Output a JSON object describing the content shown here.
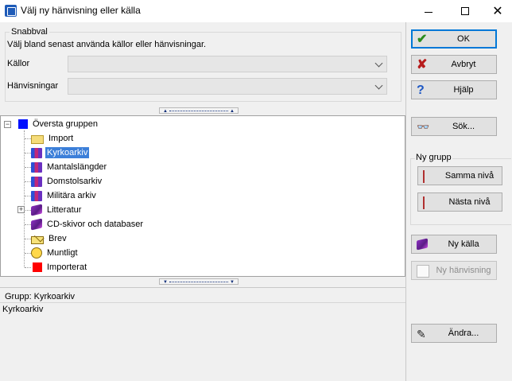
{
  "window": {
    "title": "Välj ny hänvisning eller källa",
    "minimize": "—",
    "maximize": "☐",
    "close": "✕"
  },
  "quick": {
    "title": "Snabbval",
    "description": "Välj bland senast använda källor eller hänvisningar.",
    "sources_label": "Källor",
    "sources_value": "",
    "references_label": "Hänvisningar",
    "references_value": ""
  },
  "tree": {
    "root": {
      "label": "Översta gruppen",
      "icon": "blue-square-icon",
      "expander": "−"
    },
    "items": [
      {
        "label": "Import",
        "icon": "folder-icon",
        "selected": false
      },
      {
        "label": "Kyrkoarkiv",
        "icon": "books-icon",
        "selected": true
      },
      {
        "label": "Mantalslängder",
        "icon": "books-icon",
        "selected": false
      },
      {
        "label": "Domstolsarkiv",
        "icon": "books-icon",
        "selected": false
      },
      {
        "label": "Militära arkiv",
        "icon": "books-icon",
        "selected": false
      },
      {
        "label": "Litteratur",
        "icon": "book-icon",
        "selected": false,
        "expander": "+"
      },
      {
        "label": "CD-skivor och databaser",
        "icon": "book-icon",
        "selected": false
      },
      {
        "label": "Brev",
        "icon": "envelope-icon",
        "selected": false
      },
      {
        "label": "Muntligt",
        "icon": "face-icon",
        "selected": false
      },
      {
        "label": "Importerat",
        "icon": "red-square-icon",
        "selected": false
      }
    ]
  },
  "info": {
    "group_label": "Grupp: Kyrkoarkiv",
    "value": "Kyrkoarkiv"
  },
  "buttons": {
    "ok": "OK",
    "cancel": "Avbryt",
    "help": "Hjälp",
    "search": "Sök...",
    "new_group_title": "Ny grupp",
    "same_level": "Samma nivå",
    "next_level": "Nästa nivå",
    "new_source": "Ny källa",
    "new_reference": "Ny hänvisning",
    "edit": "Ändra..."
  },
  "colors": {
    "selection": "#3c7fd9",
    "default_border": "#0078d7"
  }
}
